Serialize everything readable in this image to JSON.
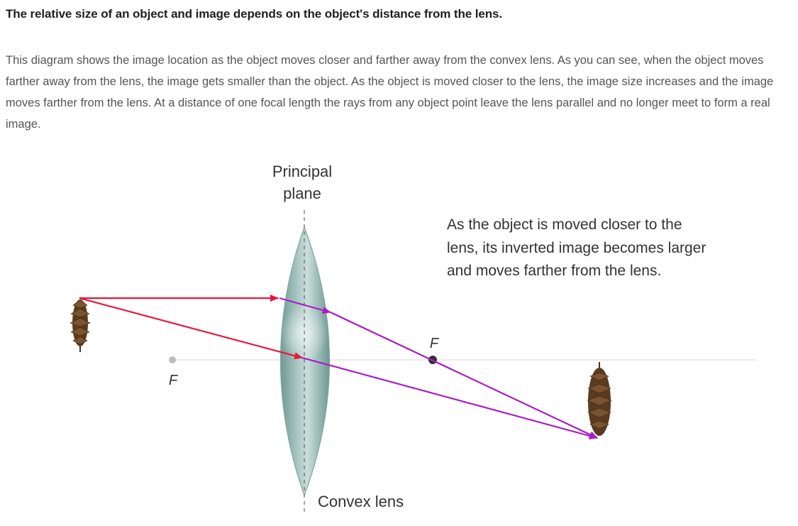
{
  "heading": "The relative size of an object and image depends on the object's distance from the lens.",
  "description": "This diagram shows the image location as the object moves closer and farther away from the convex lens. As you can see, when the object moves farther away from the lens, the image gets smaller than the object. As the object is moved closer to the lens, the image size increases and the image moves farther from the lens. At a distance of one focal length the rays from any object point leave the lens parallel and no longer meet to form a real image.",
  "diagram": {
    "principal_plane_label": [
      "Principal",
      "plane"
    ],
    "annotation_lines": [
      "As the object is moved closer to the",
      "lens, its inverted image becomes larger",
      "and moves farther from the lens."
    ],
    "focal_left_label": "F",
    "focal_right_label": "F",
    "lens_label": "Convex lens",
    "colors": {
      "incident_ray": "#e8173a",
      "refracted_ray": "#a81cc4",
      "lens_fill": "#8fb3ae",
      "axis": "#d9d9d9",
      "pinecone": "#6b4a2a"
    }
  }
}
